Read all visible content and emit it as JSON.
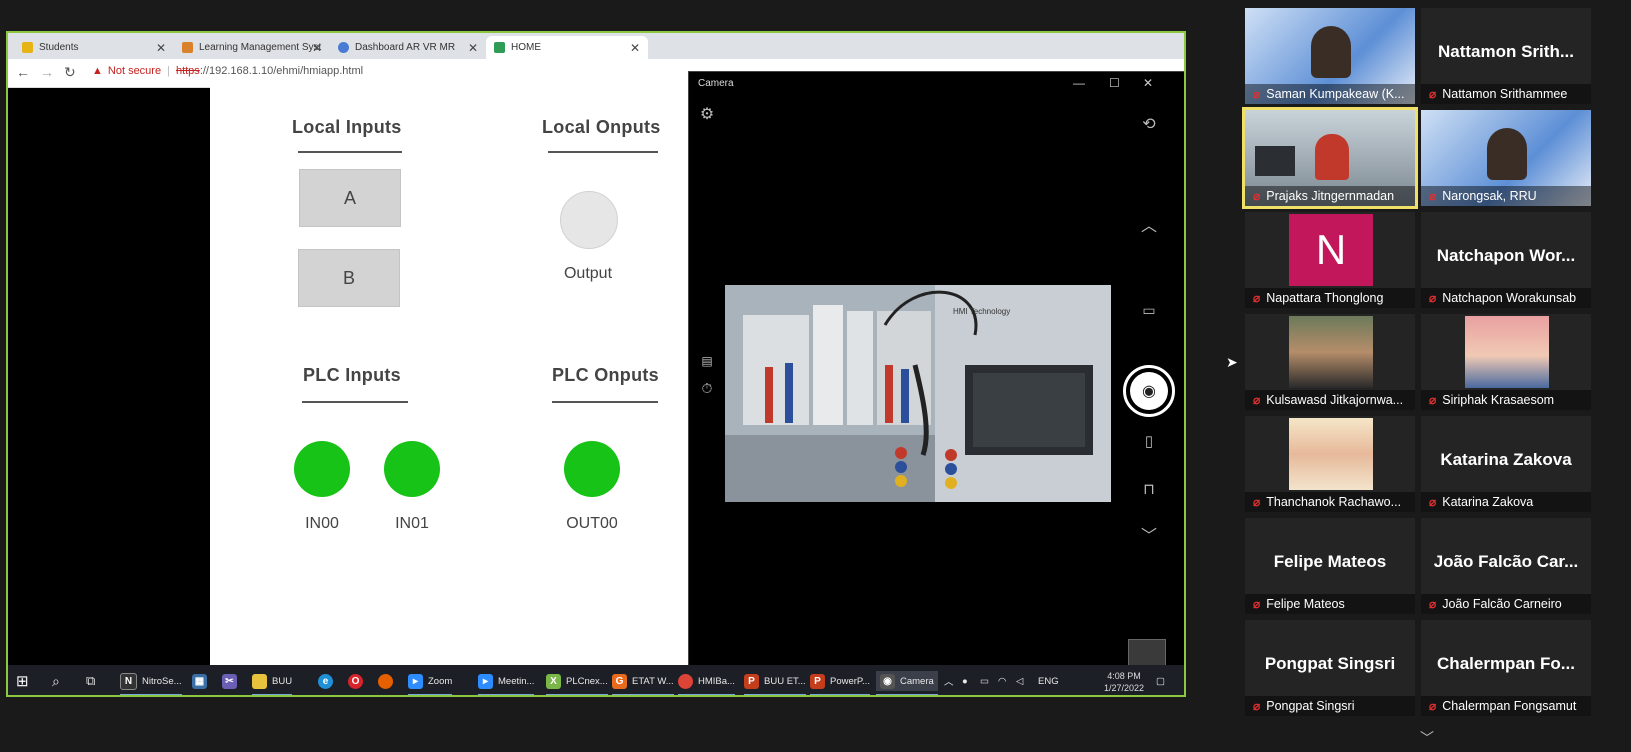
{
  "browser": {
    "tabs": [
      {
        "title": "Students",
        "color": "#e7b416"
      },
      {
        "title": "Learning Management Syst",
        "color": "#d9822b"
      },
      {
        "title": "Dashboard AR VR MR",
        "color": "#4a7bd4"
      },
      {
        "title": "HOME",
        "color": "#2e9c55"
      }
    ],
    "security": "Not secure",
    "url_scheme": "https",
    "url_rest": "://192.168.1.10/ehmi/hmiapp.html"
  },
  "hmi": {
    "local_inputs_title": "Local Inputs",
    "local_outputs_title": "Local Onputs",
    "button_a": "A",
    "button_b": "B",
    "output_label": "Output",
    "plc_inputs_title": "PLC Inputs",
    "plc_outputs_title": "PLC Onputs",
    "in00": "IN00",
    "in01": "IN01",
    "out00": "OUT00",
    "lamp_on_color": "#16c316",
    "lamp_off_color": "#e6e6e6"
  },
  "camera": {
    "title": "Camera",
    "preview_text": "HMI Technology"
  },
  "taskbar": {
    "apps": [
      "NitroSe...",
      "BUU",
      "Zoom",
      "Meetin...",
      "PLCnex...",
      "ETAT W...",
      "HMIBa...",
      "BUU ET...",
      "PowerP...",
      "Camera"
    ],
    "lang": "ENG",
    "time": "4:08 PM",
    "date": "1/27/2022"
  },
  "participants": [
    {
      "name": "Saman Kumpakeaw (K...",
      "big": "",
      "kind": "slide"
    },
    {
      "name": "Nattamon Srithammee",
      "big": "Nattamon Srith...",
      "kind": "text"
    },
    {
      "name": "Prajaks Jitngernmadan",
      "big": "",
      "kind": "lab"
    },
    {
      "name": "Narongsak, RRU",
      "big": "",
      "kind": "slide"
    },
    {
      "name": "Napattara Thonglong",
      "big": "N",
      "kind": "avatar"
    },
    {
      "name": "Natchapon Worakunsab",
      "big": "Natchapon Wor...",
      "kind": "text"
    },
    {
      "name": "Kulsawasd Jitkajornwa...",
      "big": "",
      "kind": "photo"
    },
    {
      "name": "Siriphak Krasaesom",
      "big": "",
      "kind": "anime"
    },
    {
      "name": "Thanchanok Rachawo...",
      "big": "",
      "kind": "photo2"
    },
    {
      "name": "Katarina Zakova",
      "big": "Katarina Zakova",
      "kind": "text"
    },
    {
      "name": "Felipe Mateos",
      "big": "Felipe Mateos",
      "kind": "text"
    },
    {
      "name": "João Falcão Carneiro",
      "big": "João Falcão Car...",
      "kind": "text"
    },
    {
      "name": "Pongpat Singsri",
      "big": "Pongpat Singsri",
      "kind": "text"
    },
    {
      "name": "Chalermpan Fongsamut",
      "big": "Chalermpan Fo...",
      "kind": "text"
    }
  ]
}
